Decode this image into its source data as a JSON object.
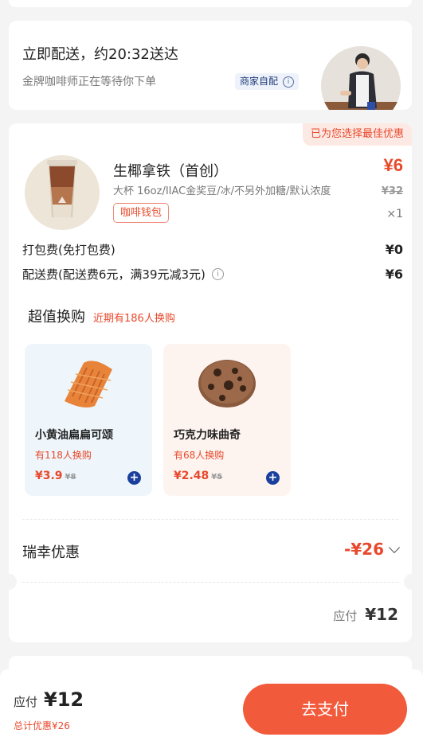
{
  "delivery": {
    "title": "立即配送，约20:32送达",
    "subtitle": "金牌咖啡师正在等待你下单",
    "merchant_badge": "商家自配",
    "info_glyph": "i"
  },
  "order": {
    "best_offer_tag": "已为您选择最佳优惠",
    "product": {
      "name": "生椰拿铁（首创）",
      "spec": "大杯 16oz/IIAC金奖豆/冰/不另外加糖/默认浓度",
      "wallet_button": "咖啡钱包",
      "price": "¥6",
      "original_price": "¥32",
      "quantity": "×1"
    },
    "fees": [
      {
        "label": "打包费(免打包费)",
        "amount": "¥0"
      },
      {
        "label": "配送费(配送费6元，满39元减3元)",
        "amount": "¥6"
      }
    ],
    "swap": {
      "title": "超值换购",
      "subtitle": "近期有186人换购",
      "items": [
        {
          "name": "小黄油扁扁可颂",
          "count": "有118人换购",
          "price": "¥3.9",
          "old_price": "¥8"
        },
        {
          "name": "巧克力味曲奇",
          "count": "有68人换购",
          "price": "¥2.48",
          "old_price": "¥5"
        }
      ]
    },
    "promo": {
      "label": "瑞幸优惠",
      "value": "-¥26"
    },
    "due": {
      "label": "应付",
      "value": "¥12"
    }
  },
  "bottom": {
    "pay_label": "应付",
    "pay_value": "¥12",
    "total_discount": "总计优惠¥26",
    "pay_button": "去支付"
  },
  "colors": {
    "accent": "#e8492c",
    "button": "#f25a3c",
    "navy": "#1a3f9c"
  }
}
